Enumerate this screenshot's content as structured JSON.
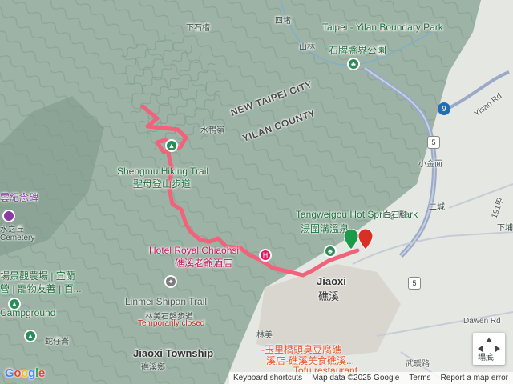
{
  "map": {
    "colors": {
      "mountain": "#9db3a5",
      "mountain_dark": "#6f8a7c",
      "plain": "#e4e7e2",
      "water": "#a9d3e6",
      "highway": "#9aa9c7",
      "route": "#f0637a",
      "river": "#7aaed0"
    }
  },
  "labels": {
    "xiashicao": "下石槽",
    "sijie": "四堵",
    "shanlin": "山林",
    "boundary_park_en": "Taipei - Yilan Boundary Park",
    "boundary_park_zh": "石牌縣界公園",
    "new_taipei": "NEW TAIPEI CITY",
    "yilan": "YILAN COUNTY",
    "shuiyazhi": "水鴨嶺",
    "shengmu_trail_en": "Shengmu Hiking Trail",
    "shengmu_trail_zh": "聖母登山步道",
    "memorial": "雲紀念碑",
    "xiaojinmian": "小金面",
    "tangweigou_en": "Tangweigou Hot Spring Park",
    "tangweigou_zh": "湯圍溝溫泉",
    "baishijiao": "白石腳",
    "ercheng": "二城",
    "jinsanli": "下埔",
    "hotel_en": "Hotel Royal Chiaohsi",
    "hotel_zh": "礁溪老爺酒店",
    "water_hill": "水之丘",
    "cemetery": "Cemetery",
    "farm_line1": "場景觀農場 | 宜蘭",
    "farm_line2": "營 | 寵物友善 | 百...",
    "campground": "Campground",
    "shezi": "蛇仔崙",
    "linmei_trail_en": "Linmei Shipan Trail",
    "linmei_trail_zh": "林美石磐步道",
    "temp_closed": "Temporarily closed",
    "linmei": "林美",
    "jiaoxi_en": "Jiaoxi",
    "jiaoxi_zh": "礁溪",
    "jiaoxi_township": "Jiaoxi Township",
    "jiaoxi_township_zh": "礁溪鄉",
    "dawen_rd": "Dawen Rd",
    "yusan_rd": "Yisan Rd",
    "road_191": "191甲",
    "wu_wu_rd": "武暖路",
    "tangchi": "塌底",
    "food_line1": "-玉里橋頭臭豆腐礁",
    "food_line2": "溪店-礁溪美食礁溪...",
    "food_en": "Tofu restaurant"
  },
  "shields": {
    "hwy9": "9",
    "hwy5a": "5",
    "hwy5b": "5",
    "exit2": "2"
  },
  "pins": {
    "trail_start": "▲",
    "hotel": "H",
    "camp": "▲",
    "trail_linmei": "✦",
    "tree1": "♣",
    "tree2": "♣"
  },
  "compass": {
    "icon": "compass-icon"
  },
  "attribution": {
    "google": "Google",
    "shortcuts": "Keyboard shortcuts",
    "mapdata": "Map data ©2025 Google",
    "terms": "Terms",
    "report": "Report a map error"
  }
}
